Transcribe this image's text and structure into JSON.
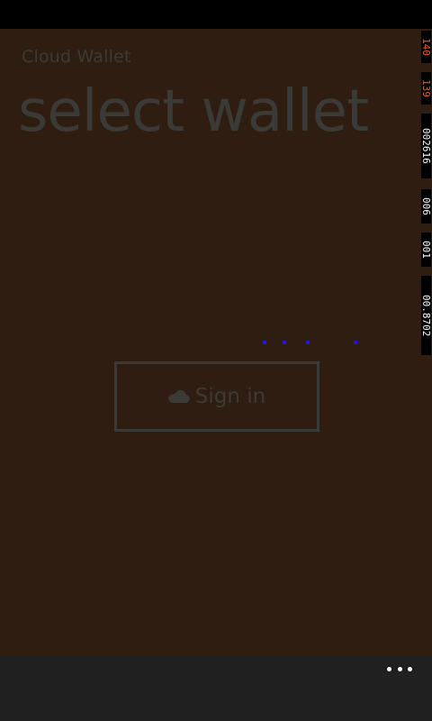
{
  "app": {
    "name": "Cloud Wallet",
    "page_title": "select wallet"
  },
  "sign_in": {
    "label": "Sign in",
    "icon": "cloud-icon"
  },
  "debug_counters": [
    "140",
    "139",
    "002616",
    "006",
    "001",
    "00.8702"
  ],
  "app_bar": {
    "more_icon": "ellipsis-icon"
  },
  "colors": {
    "background": "#301d12",
    "app_bar": "#202020",
    "text_dim": "#3a3a36",
    "progress": "#1a1adf",
    "counter_red": "#e05a2a"
  }
}
